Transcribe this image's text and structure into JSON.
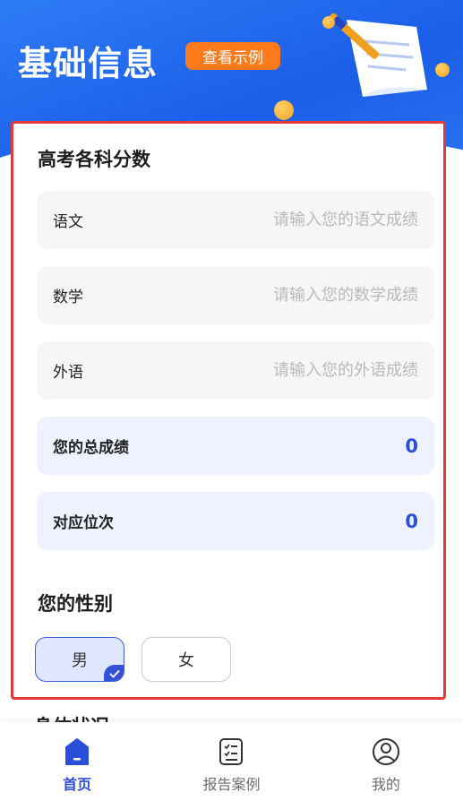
{
  "header": {
    "title": "基础信息",
    "example_button": "查看示例"
  },
  "scores_section": {
    "title": "高考各科分数",
    "fields": [
      {
        "label": "语文",
        "placeholder": "请输入您的语文成绩",
        "value": ""
      },
      {
        "label": "数学",
        "placeholder": "请输入您的数学成绩",
        "value": ""
      },
      {
        "label": "外语",
        "placeholder": "请输入您的外语成绩",
        "value": ""
      }
    ],
    "total": {
      "label": "您的总成绩",
      "value": "0"
    },
    "rank": {
      "label": "对应位次",
      "value": "0"
    }
  },
  "gender_section": {
    "title": "您的性别",
    "options": [
      {
        "label": "男",
        "selected": true
      },
      {
        "label": "女",
        "selected": false
      }
    ]
  },
  "next_section": {
    "title": "身体状况"
  },
  "tabbar": {
    "items": [
      {
        "label": "首页",
        "icon": "home-icon",
        "active": true
      },
      {
        "label": "报告案例",
        "icon": "report-list-icon",
        "active": false
      },
      {
        "label": "我的",
        "icon": "user-icon",
        "active": false
      }
    ]
  },
  "colors": {
    "primary": "#2b4fd8",
    "header_blue": "#1b5ee8",
    "accent_orange": "#ff7a1a",
    "highlight_border": "#e53a3a"
  }
}
